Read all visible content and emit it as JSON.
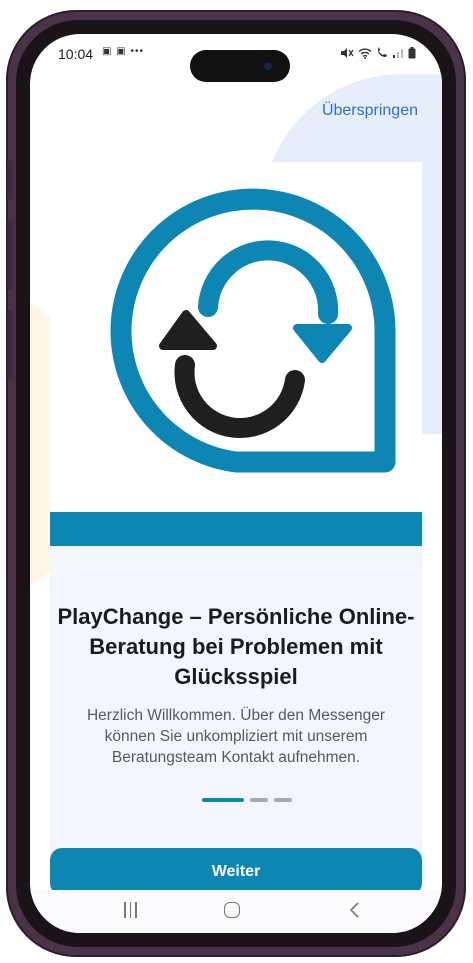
{
  "status_bar": {
    "time": "10:04",
    "notification_icons": "▣ ▣ •••",
    "right_icons": [
      "mute-icon",
      "wifi-icon",
      "volte-icon",
      "signal-icon",
      "battery-icon"
    ]
  },
  "header": {
    "skip_label": "Überspringen"
  },
  "onboarding": {
    "title": "PlayChange – Persönliche Online-Beratung bei Problemen mit Glücksspiel",
    "subtitle": "Herzlich Willkommen. Über den Messenger können Sie unkompliziert mit unserem Beratungsteam Kontakt aufnehmen.",
    "hero_icon": "refresh-speech-bubble-icon",
    "page_total": 3,
    "page_current": 1,
    "next_label": "Weiter"
  },
  "colors": {
    "brand_blue": "#0d86b4",
    "link_blue": "#2f6fc6",
    "icon_dark": "#1f1f1f",
    "panel_bg": "#f3f7fd"
  },
  "nav_bar": {
    "buttons": [
      "recents-icon",
      "home-icon",
      "back-icon"
    ]
  }
}
